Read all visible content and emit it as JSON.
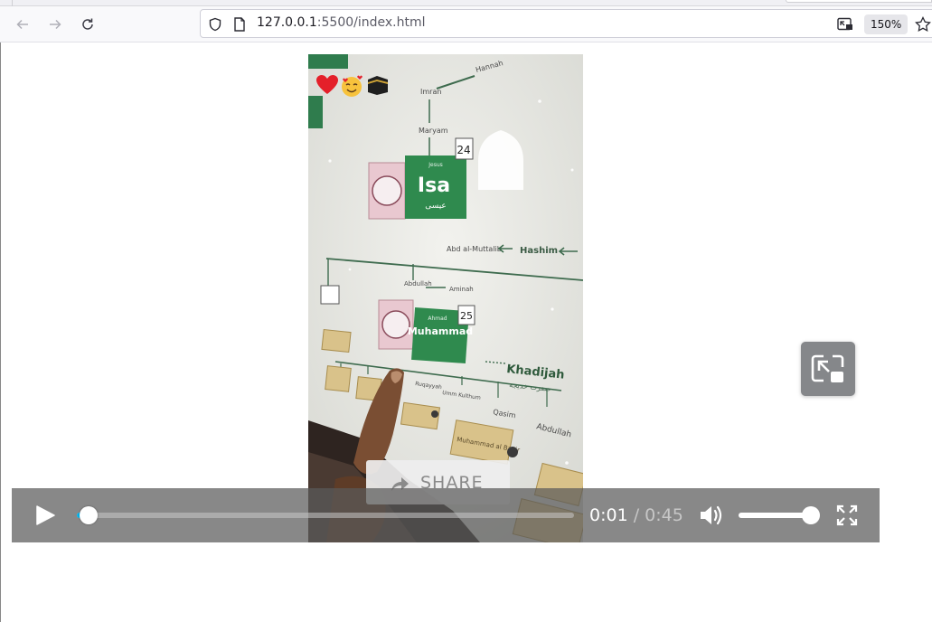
{
  "browser": {
    "url_host": "127.0.0.1",
    "url_path": ":5500/index.html",
    "zoom_label": "150%"
  },
  "video": {
    "emoji_icons": [
      "heart-emoji",
      "smiling-face-with-hearts-emoji",
      "kaaba-emoji"
    ],
    "tree_labels": {
      "imran": "Imran",
      "hannah": "Hannah",
      "maryam": "Maryam",
      "jesus": "Jesus",
      "isa": "Isa",
      "isa_arabic": "عيسى",
      "isa_number": "24",
      "abd_al_muttalib": "Abd al-Muttalib",
      "hashim": "Hashim",
      "abdullah": "Abdullah",
      "aminah": "Aminah",
      "ahmad": "Ahmad",
      "muhammad": "Muhammad",
      "muhammad_number": "25",
      "khadijah": "Khadijah",
      "khadijah_arabic": "حضرت خديجه",
      "qasim": "Qasim",
      "abdullah_son": "Abdullah",
      "umm_kulthum": "Umm Kulthum",
      "ruqayyah": "Ruqayyah",
      "muhammad_al_baqir": "Muhammad al Baqir"
    },
    "share_label": "SHARE"
  },
  "controls": {
    "current_time": "0:01",
    "separator": "/",
    "duration": "0:45",
    "progress_fraction": 0.024,
    "buffered_fraction": 0.03,
    "volume_fraction": 1.0,
    "accent_color": "#00b6f0"
  }
}
